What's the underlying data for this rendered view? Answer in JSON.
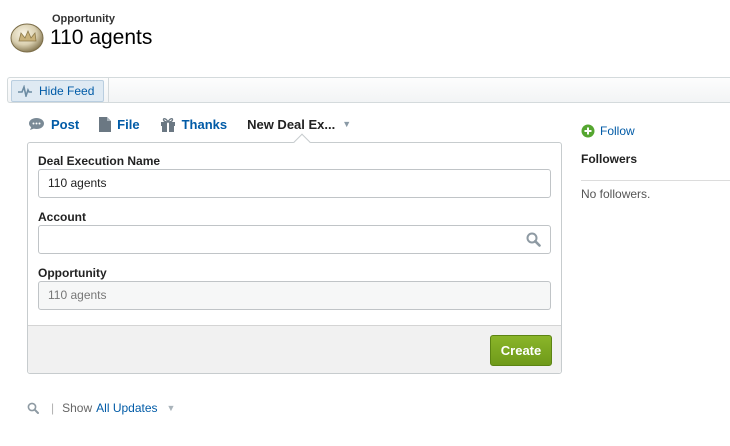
{
  "header": {
    "record_type": "Opportunity",
    "record_title": "110 agents"
  },
  "feed_bar": {
    "hide_feed_label": "Hide Feed"
  },
  "publisher": {
    "tabs": [
      {
        "label": "Post",
        "icon": "chat-bubble-icon"
      },
      {
        "label": "File",
        "icon": "file-icon"
      },
      {
        "label": "Thanks",
        "icon": "gift-icon"
      },
      {
        "label": "New Deal Ex...",
        "icon": "chevron-down-icon",
        "active": true
      }
    ],
    "fields": {
      "deal_execution_name": {
        "label": "Deal Execution Name",
        "value": "110 agents"
      },
      "account": {
        "label": "Account",
        "value": "",
        "icon": "search-icon"
      },
      "opportunity": {
        "label": "Opportunity",
        "value": "110 agents"
      }
    },
    "create_label": "Create"
  },
  "feed_filter": {
    "show_label": "Show",
    "value": "All Updates"
  },
  "sidebar": {
    "follow_label": "Follow",
    "followers_title": "Followers",
    "no_followers_text": "No followers."
  },
  "colors": {
    "link": "#015ba7",
    "create_button": "#7aa722",
    "follow_icon": "#55a630"
  }
}
